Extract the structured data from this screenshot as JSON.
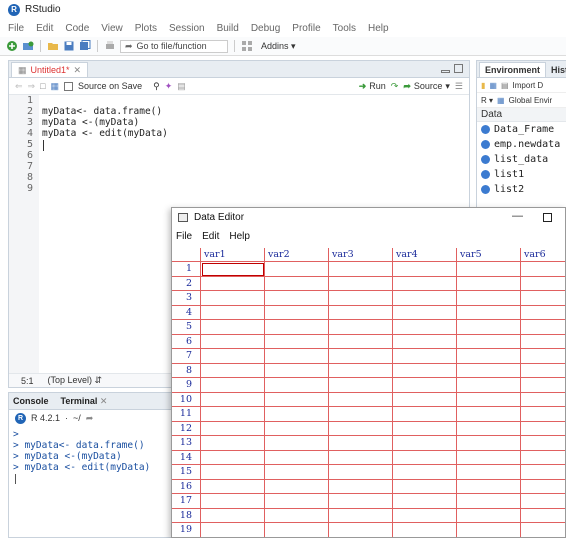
{
  "app": {
    "title": "RStudio"
  },
  "menu": [
    "File",
    "Edit",
    "Code",
    "View",
    "Plots",
    "Session",
    "Build",
    "Debug",
    "Profile",
    "Tools",
    "Help"
  ],
  "toolbar": {
    "goto_placeholder": "Go to file/function",
    "addins_label": "Addins"
  },
  "source": {
    "tab_label": "Untitled1*",
    "source_on_save": "Source on Save",
    "run_label": "Run",
    "source_label": "Source",
    "line_numbers": [
      "1",
      "2",
      "3",
      "4",
      "5",
      "6",
      "7",
      "8",
      "9"
    ],
    "code_lines": [
      "",
      "myData<- data.frame()",
      "myData <-(myData)",
      "myData <- edit(myData)",
      "",
      "",
      "",
      "",
      ""
    ],
    "status_position": "5:1",
    "status_scope": "(Top Level)"
  },
  "console": {
    "tabs": [
      "Console",
      "Terminal"
    ],
    "version": "R 4.2.1",
    "path": "~/",
    "lines": [
      ">",
      "> myData<- data.frame()",
      "> myData <-(myData)",
      "> myData <- edit(myData)"
    ]
  },
  "environment": {
    "tabs": [
      "Environment",
      "Histo"
    ],
    "import_label": "Import D",
    "r_label": "R",
    "global_env_label": "Global Envir",
    "section_label": "Data",
    "items": [
      "Data_Frame",
      "emp.newdata",
      "list_data",
      "list1",
      "list2"
    ]
  },
  "data_editor": {
    "title": "Data Editor",
    "menu": [
      "File",
      "Edit",
      "Help"
    ],
    "columns": [
      "var1",
      "var2",
      "var3",
      "var4",
      "var5",
      "var6"
    ],
    "rows": [
      "1",
      "2",
      "3",
      "4",
      "5",
      "6",
      "7",
      "8",
      "9",
      "10",
      "11",
      "12",
      "13",
      "14",
      "15",
      "16",
      "17",
      "18",
      "19"
    ]
  },
  "colors": {
    "accent": "#2165b6",
    "grid_line": "#e06060",
    "grid_text": "#1a2a9a",
    "tab_modified": "#d33333"
  }
}
